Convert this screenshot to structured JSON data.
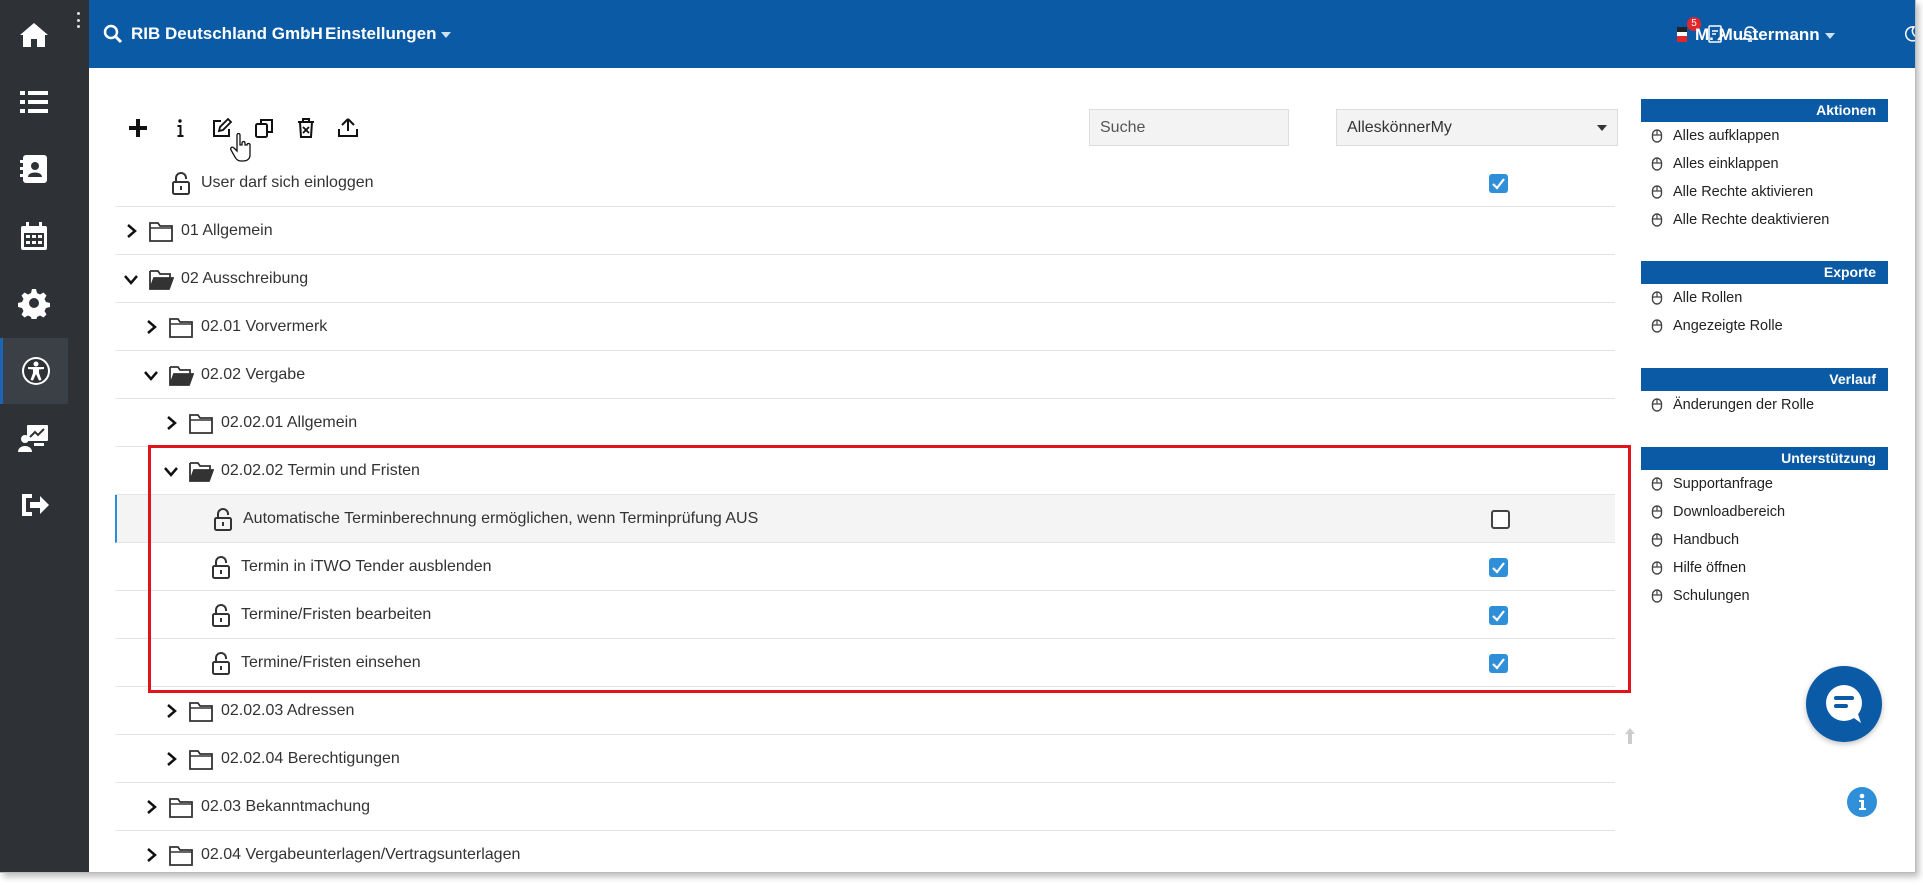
{
  "header": {
    "company": "RIB Deutschland GmbH",
    "section": "Einstellungen",
    "notification_count": "5",
    "user": "M. Mustermann"
  },
  "sidebar": {
    "items": [
      {
        "icon": "home-icon"
      },
      {
        "icon": "list-icon"
      },
      {
        "icon": "contacts-icon"
      },
      {
        "icon": "calendar-icon"
      },
      {
        "icon": "settings-icon"
      },
      {
        "icon": "accessibility-icon",
        "active": true
      },
      {
        "icon": "presentation-icon"
      },
      {
        "icon": "logout-icon"
      }
    ]
  },
  "toolbar": {
    "search_placeholder": "Suche",
    "role_selected": "AlleskönnerMy"
  },
  "tree": [
    {
      "label": "User darf sich einloggen",
      "type": "perm",
      "checked": true
    },
    {
      "label": "01 Allgemein",
      "type": "folder"
    },
    {
      "label": "02 Ausschreibung",
      "type": "folder-open"
    },
    {
      "label": "02.01 Vorvermerk",
      "type": "folder"
    },
    {
      "label": "02.02 Vergabe",
      "type": "folder-open"
    },
    {
      "label": "02.02.01 Allgemein",
      "type": "folder"
    },
    {
      "label": "02.02.02 Termin und Fristen",
      "type": "folder-open"
    },
    {
      "label": "Automatische Terminberechnung ermöglichen, wenn Terminprüfung AUS",
      "type": "perm",
      "checked": false
    },
    {
      "label": "Termin in iTWO Tender ausblenden",
      "type": "perm",
      "checked": true
    },
    {
      "label": "Termine/Fristen bearbeiten",
      "type": "perm",
      "checked": true
    },
    {
      "label": "Termine/Fristen einsehen",
      "type": "perm",
      "checked": true
    },
    {
      "label": "02.02.03 Adressen",
      "type": "folder"
    },
    {
      "label": "02.02.04 Berechtigungen",
      "type": "folder"
    },
    {
      "label": "02.03 Bekanntmachung",
      "type": "folder"
    },
    {
      "label": "02.04 Vergabeunterlagen/Vertragsunterlagen",
      "type": "folder"
    }
  ],
  "right_panel": {
    "aktionen": {
      "title": "Aktionen",
      "items": [
        "Alles aufklappen",
        "Alles einklappen",
        "Alle Rechte aktivieren",
        "Alle Rechte deaktivieren"
      ]
    },
    "exporte": {
      "title": "Exporte",
      "items": [
        "Alle Rollen",
        "Angezeigte Rolle"
      ]
    },
    "verlauf": {
      "title": "Verlauf",
      "items": [
        "Änderungen der Rolle"
      ]
    },
    "unterstuetzung": {
      "title": "Unterstützung",
      "items": [
        "Supportanfrage",
        "Downloadbereich",
        "Handbuch",
        "Hilfe öffnen",
        "Schulungen"
      ]
    }
  },
  "colors": {
    "header_blue": "#0b5aa6",
    "sidebar_dark": "#2e3236",
    "checkbox_blue": "#2f8fd8",
    "highlight_red": "#e0141b"
  }
}
